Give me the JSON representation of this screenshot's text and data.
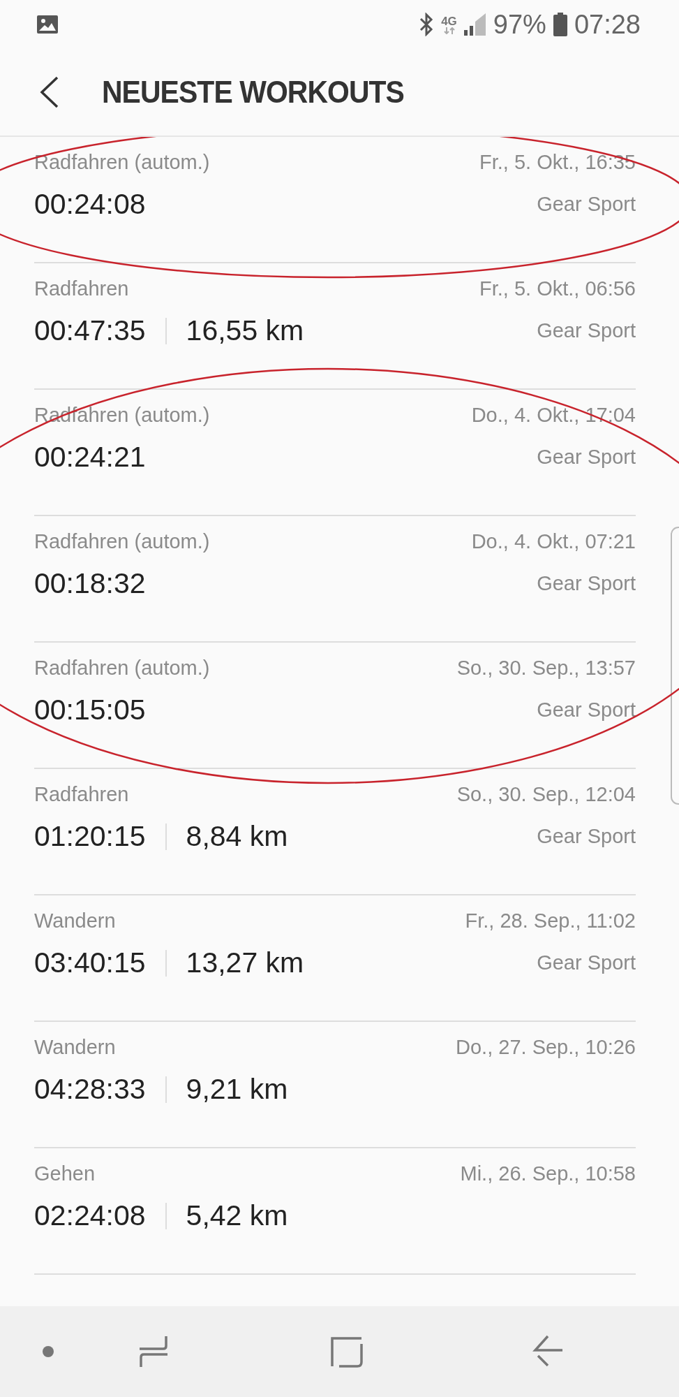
{
  "status_bar": {
    "network_type": "4G",
    "battery": "97%",
    "time": "07:28"
  },
  "header": {
    "title": "NEUESTE WORKOUTS"
  },
  "workouts": [
    {
      "activity": "Radfahren (autom.)",
      "duration": "00:24:08",
      "date": "Fr., 5. Okt., 16:35",
      "device": "Gear Sport",
      "circled": true
    },
    {
      "activity": "Radfahren",
      "duration": "00:47:35",
      "distance": "16,55 km",
      "date": "Fr., 5. Okt., 06:56",
      "device": "Gear Sport",
      "circled": false
    },
    {
      "activity": "Radfahren (autom.)",
      "duration": "00:24:21",
      "date": "Do., 4. Okt., 17:04",
      "device": "Gear Sport",
      "circled": true
    },
    {
      "activity": "Radfahren (autom.)",
      "duration": "00:18:32",
      "date": "Do., 4. Okt., 07:21",
      "device": "Gear Sport",
      "circled": true
    },
    {
      "activity": "Radfahren (autom.)",
      "duration": "00:15:05",
      "date": "So., 30. Sep., 13:57",
      "device": "Gear Sport",
      "circled": true
    },
    {
      "activity": "Radfahren",
      "duration": "01:20:15",
      "distance": "8,84 km",
      "date": "So., 30. Sep., 12:04",
      "device": "Gear Sport",
      "circled": false
    },
    {
      "activity": "Wandern",
      "duration": "03:40:15",
      "distance": "13,27 km",
      "date": "Fr., 28. Sep., 11:02",
      "device": "Gear Sport",
      "circled": false
    },
    {
      "activity": "Wandern",
      "duration": "04:28:33",
      "distance": "9,21 km",
      "date": "Do., 27. Sep., 10:26",
      "circled": false
    },
    {
      "activity": "Gehen",
      "duration": "02:24:08",
      "distance": "5,42 km",
      "date": "Mi., 26. Sep., 10:58",
      "circled": false
    }
  ]
}
